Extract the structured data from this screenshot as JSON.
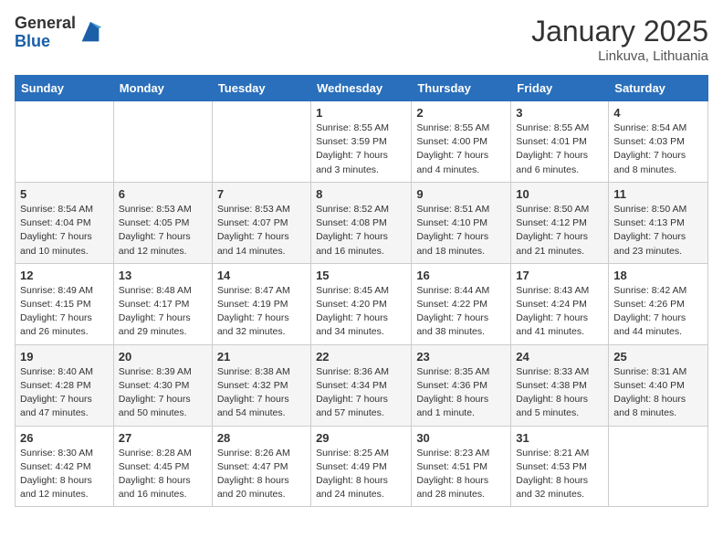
{
  "logo": {
    "general": "General",
    "blue": "Blue"
  },
  "title": "January 2025",
  "location": "Linkuva, Lithuania",
  "days_header": [
    "Sunday",
    "Monday",
    "Tuesday",
    "Wednesday",
    "Thursday",
    "Friday",
    "Saturday"
  ],
  "weeks": [
    [
      {
        "day": "",
        "info": ""
      },
      {
        "day": "",
        "info": ""
      },
      {
        "day": "",
        "info": ""
      },
      {
        "day": "1",
        "info": "Sunrise: 8:55 AM\nSunset: 3:59 PM\nDaylight: 7 hours\nand 3 minutes."
      },
      {
        "day": "2",
        "info": "Sunrise: 8:55 AM\nSunset: 4:00 PM\nDaylight: 7 hours\nand 4 minutes."
      },
      {
        "day": "3",
        "info": "Sunrise: 8:55 AM\nSunset: 4:01 PM\nDaylight: 7 hours\nand 6 minutes."
      },
      {
        "day": "4",
        "info": "Sunrise: 8:54 AM\nSunset: 4:03 PM\nDaylight: 7 hours\nand 8 minutes."
      }
    ],
    [
      {
        "day": "5",
        "info": "Sunrise: 8:54 AM\nSunset: 4:04 PM\nDaylight: 7 hours\nand 10 minutes."
      },
      {
        "day": "6",
        "info": "Sunrise: 8:53 AM\nSunset: 4:05 PM\nDaylight: 7 hours\nand 12 minutes."
      },
      {
        "day": "7",
        "info": "Sunrise: 8:53 AM\nSunset: 4:07 PM\nDaylight: 7 hours\nand 14 minutes."
      },
      {
        "day": "8",
        "info": "Sunrise: 8:52 AM\nSunset: 4:08 PM\nDaylight: 7 hours\nand 16 minutes."
      },
      {
        "day": "9",
        "info": "Sunrise: 8:51 AM\nSunset: 4:10 PM\nDaylight: 7 hours\nand 18 minutes."
      },
      {
        "day": "10",
        "info": "Sunrise: 8:50 AM\nSunset: 4:12 PM\nDaylight: 7 hours\nand 21 minutes."
      },
      {
        "day": "11",
        "info": "Sunrise: 8:50 AM\nSunset: 4:13 PM\nDaylight: 7 hours\nand 23 minutes."
      }
    ],
    [
      {
        "day": "12",
        "info": "Sunrise: 8:49 AM\nSunset: 4:15 PM\nDaylight: 7 hours\nand 26 minutes."
      },
      {
        "day": "13",
        "info": "Sunrise: 8:48 AM\nSunset: 4:17 PM\nDaylight: 7 hours\nand 29 minutes."
      },
      {
        "day": "14",
        "info": "Sunrise: 8:47 AM\nSunset: 4:19 PM\nDaylight: 7 hours\nand 32 minutes."
      },
      {
        "day": "15",
        "info": "Sunrise: 8:45 AM\nSunset: 4:20 PM\nDaylight: 7 hours\nand 34 minutes."
      },
      {
        "day": "16",
        "info": "Sunrise: 8:44 AM\nSunset: 4:22 PM\nDaylight: 7 hours\nand 38 minutes."
      },
      {
        "day": "17",
        "info": "Sunrise: 8:43 AM\nSunset: 4:24 PM\nDaylight: 7 hours\nand 41 minutes."
      },
      {
        "day": "18",
        "info": "Sunrise: 8:42 AM\nSunset: 4:26 PM\nDaylight: 7 hours\nand 44 minutes."
      }
    ],
    [
      {
        "day": "19",
        "info": "Sunrise: 8:40 AM\nSunset: 4:28 PM\nDaylight: 7 hours\nand 47 minutes."
      },
      {
        "day": "20",
        "info": "Sunrise: 8:39 AM\nSunset: 4:30 PM\nDaylight: 7 hours\nand 50 minutes."
      },
      {
        "day": "21",
        "info": "Sunrise: 8:38 AM\nSunset: 4:32 PM\nDaylight: 7 hours\nand 54 minutes."
      },
      {
        "day": "22",
        "info": "Sunrise: 8:36 AM\nSunset: 4:34 PM\nDaylight: 7 hours\nand 57 minutes."
      },
      {
        "day": "23",
        "info": "Sunrise: 8:35 AM\nSunset: 4:36 PM\nDaylight: 8 hours\nand 1 minute."
      },
      {
        "day": "24",
        "info": "Sunrise: 8:33 AM\nSunset: 4:38 PM\nDaylight: 8 hours\nand 5 minutes."
      },
      {
        "day": "25",
        "info": "Sunrise: 8:31 AM\nSunset: 4:40 PM\nDaylight: 8 hours\nand 8 minutes."
      }
    ],
    [
      {
        "day": "26",
        "info": "Sunrise: 8:30 AM\nSunset: 4:42 PM\nDaylight: 8 hours\nand 12 minutes."
      },
      {
        "day": "27",
        "info": "Sunrise: 8:28 AM\nSunset: 4:45 PM\nDaylight: 8 hours\nand 16 minutes."
      },
      {
        "day": "28",
        "info": "Sunrise: 8:26 AM\nSunset: 4:47 PM\nDaylight: 8 hours\nand 20 minutes."
      },
      {
        "day": "29",
        "info": "Sunrise: 8:25 AM\nSunset: 4:49 PM\nDaylight: 8 hours\nand 24 minutes."
      },
      {
        "day": "30",
        "info": "Sunrise: 8:23 AM\nSunset: 4:51 PM\nDaylight: 8 hours\nand 28 minutes."
      },
      {
        "day": "31",
        "info": "Sunrise: 8:21 AM\nSunset: 4:53 PM\nDaylight: 8 hours\nand 32 minutes."
      },
      {
        "day": "",
        "info": ""
      }
    ]
  ]
}
